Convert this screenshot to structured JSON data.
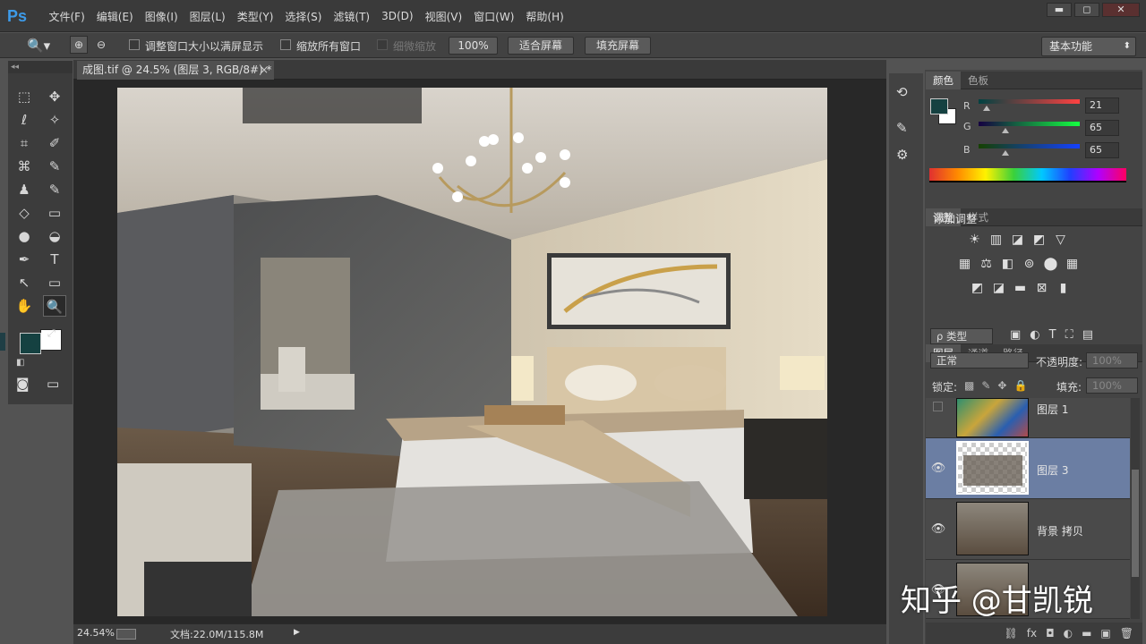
{
  "app": {
    "logo": "Ps"
  },
  "menu": [
    "文件(F)",
    "编辑(E)",
    "图像(I)",
    "图层(L)",
    "类型(Y)",
    "选择(S)",
    "滤镜(T)",
    "3D(D)",
    "视图(V)",
    "窗口(W)",
    "帮助(H)"
  ],
  "window_controls": {
    "minimize": "▬",
    "restore": "◻",
    "close": "✕"
  },
  "options_bar": {
    "resize_windows": "调整窗口大小以满屏显示",
    "zoom_all_windows": "缩放所有窗口",
    "scrubby_zoom": "细微缩放",
    "zoom_100": "100%",
    "fit_screen": "适合屏幕",
    "fill_screen": "填充屏幕",
    "workspace": "基本功能",
    "dropdown_arrow": "⬍"
  },
  "document": {
    "tab_title": "成图.tif @ 24.5% (图层 3, RGB/8#) *",
    "tab_close": "×",
    "status_zoom": "24.54%",
    "status_doc": "文档:22.0M/115.8M",
    "status_arrow": "▶"
  },
  "panels": {
    "color": {
      "tabs": [
        "颜色",
        "色板"
      ],
      "labels": {
        "r": "R",
        "g": "G",
        "b": "B"
      },
      "values": {
        "r": "21",
        "g": "65",
        "b": "65"
      },
      "fg_color": "#154141",
      "bg_color": "#ffffff"
    },
    "adjustments": {
      "tabs": [
        "调整",
        "样式"
      ],
      "title": "添加调整",
      "icons_row1": [
        "☀",
        "▥",
        "◪",
        "◩",
        "▽"
      ],
      "icons_row2": [
        "▦",
        "⚖",
        "◧",
        "⊚",
        "⬤",
        "▦"
      ],
      "icons_row3": [
        "◩",
        "◪",
        "▬",
        "⊠",
        "▮"
      ]
    },
    "layers": {
      "tabs": [
        "图层",
        "通道",
        "路径"
      ],
      "filter_kind": "ρ 类型",
      "blend_mode": "正常",
      "opacity_label": "不透明度:",
      "opacity_value": "100%",
      "lock_label": "锁定:",
      "fill_label": "填充:",
      "fill_value": "100%",
      "filter_icons": [
        "▣",
        "◐",
        "T",
        "⛶",
        "▤"
      ],
      "lock_icons": [
        "▩",
        "✎",
        "✥",
        "🔒"
      ],
      "footer_icons": [
        "⛓",
        "fx",
        "◘",
        "◐",
        "▬",
        "▣",
        "🗑"
      ],
      "items": [
        {
          "name": "图层 1",
          "visible": false
        },
        {
          "name": "图层 3",
          "visible": true,
          "selected": true
        },
        {
          "name": "背景 拷贝",
          "visible": true
        },
        {
          "name": "",
          "visible": true
        }
      ]
    }
  },
  "tools": [
    [
      "⬚",
      "✥"
    ],
    [
      "ℓ",
      "✧"
    ],
    [
      "⌗",
      "✐"
    ],
    [
      "⌘",
      "✎"
    ],
    [
      "♟",
      "✎"
    ],
    [
      "◇",
      "▭"
    ],
    [
      "●",
      "◒"
    ],
    [
      "✒",
      "T"
    ],
    [
      "↖",
      "▭"
    ],
    [
      "✋",
      "🔍"
    ]
  ],
  "swap_icon": "⤢",
  "reset_icon": "◧",
  "quickmask_icon": "◙",
  "screenmode_icon": "▭",
  "watermark": "知乎 @甘凯锐",
  "colors": {
    "fg": "#154141",
    "selected_layer": "#6b7ea3"
  }
}
